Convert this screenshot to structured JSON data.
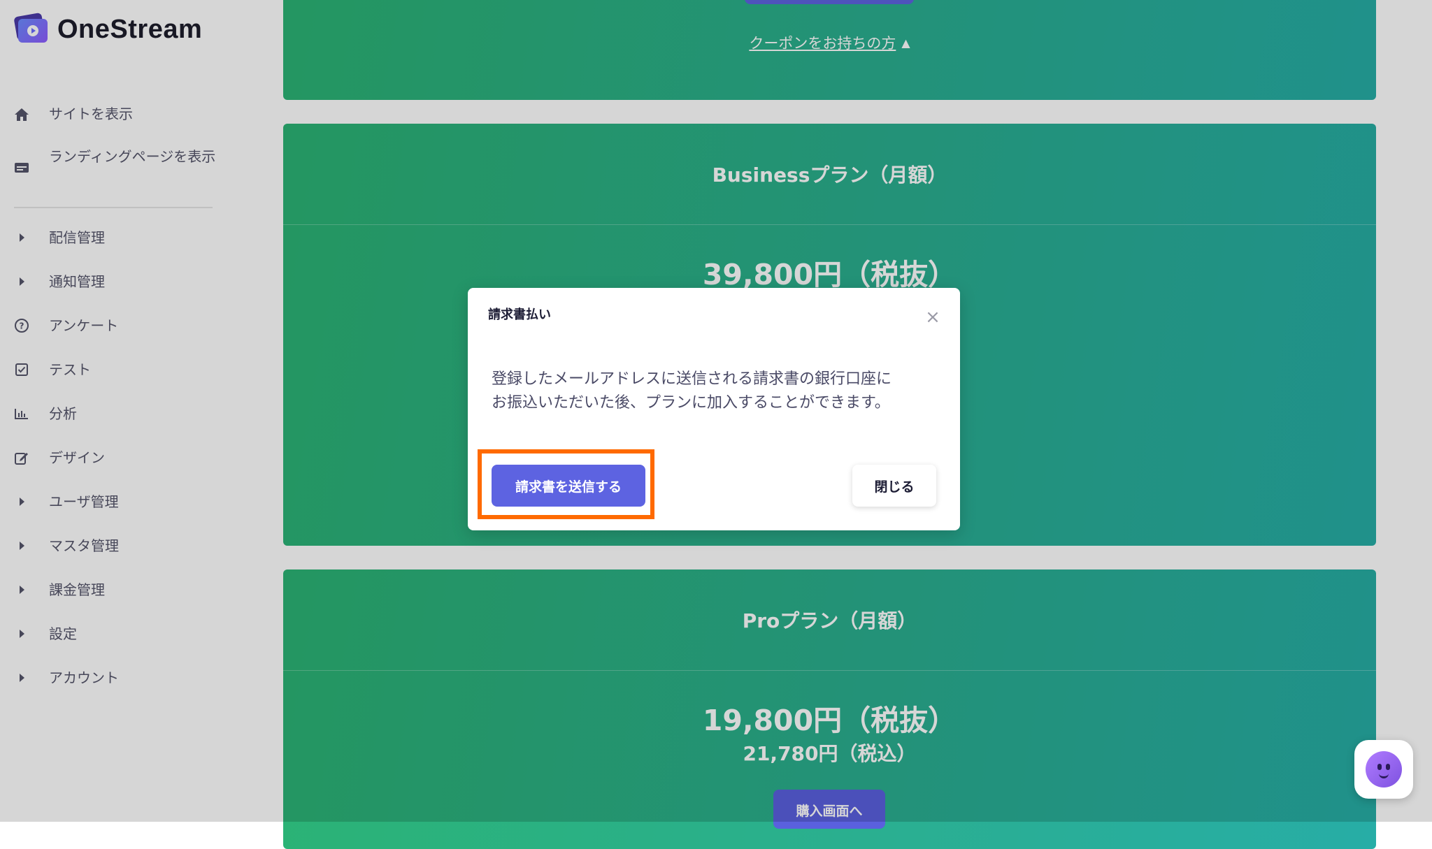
{
  "app": {
    "name": "OneStream"
  },
  "sidebar": {
    "items": [
      {
        "label": "サイトを表示",
        "icon": "home-icon"
      },
      {
        "label": "ランディングページを表示",
        "icon": "landing-page-icon"
      },
      {
        "label": "配信管理",
        "icon": "chevron-right-icon"
      },
      {
        "label": "通知管理",
        "icon": "chevron-right-icon"
      },
      {
        "label": "アンケート",
        "icon": "question-circle-icon"
      },
      {
        "label": "テスト",
        "icon": "checkbox-icon"
      },
      {
        "label": "分析",
        "icon": "bar-chart-icon"
      },
      {
        "label": "デザイン",
        "icon": "edit-icon"
      },
      {
        "label": "ユーザ管理",
        "icon": "chevron-right-icon"
      },
      {
        "label": "マスタ管理",
        "icon": "chevron-right-icon"
      },
      {
        "label": "課金管理",
        "icon": "chevron-right-icon"
      },
      {
        "label": "設定",
        "icon": "chevron-right-icon"
      },
      {
        "label": "アカウント",
        "icon": "chevron-right-icon"
      }
    ]
  },
  "main": {
    "coupon_link": "クーポンをお持ちの方",
    "plans": [
      {
        "title": "Businessプラン（月額）",
        "price_ex_tax": "39,800円（税抜）"
      },
      {
        "title": "Proプラン（月額）",
        "price_ex_tax": "19,800円（税抜）",
        "price_in_tax": "21,780円（税込）",
        "buy_label": "購入画面へ"
      }
    ]
  },
  "modal": {
    "title": "請求書払い",
    "close_symbol": "×",
    "body_lines": [
      "登録したメールアドレスに送信される請求書の銀行口座に",
      "お振込いただいた後、プランに加入することができます。"
    ],
    "send_button": "請求書を送信する",
    "close_button": "閉じる"
  },
  "colors": {
    "card_green": "#2bb374",
    "card_teal": "#27ada6",
    "primary_button": "#5d63e1",
    "highlight_border": "#ff6a00"
  }
}
